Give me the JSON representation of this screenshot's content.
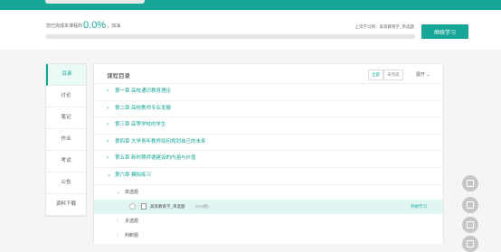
{
  "progress": {
    "prefix": "您已完成本课程的",
    "percent": "0.0%",
    "suffix": "，加油",
    "last_study": "上次学习到：高等教育学_单选题",
    "continue_label": "继续学习"
  },
  "nav": {
    "items": [
      {
        "label": "目录"
      },
      {
        "label": "讨论"
      },
      {
        "label": "笔记"
      },
      {
        "label": "作业"
      },
      {
        "label": "考试"
      },
      {
        "label": "公告"
      },
      {
        "label": "资料下载"
      }
    ]
  },
  "catalog": {
    "title": "课程目录",
    "filter_all": "全部",
    "filter_unfinished": "未完成",
    "expand_label": "展开",
    "chapters": [
      {
        "label": "第一章 高校通识教育理论"
      },
      {
        "label": "第二章 高校教师专业发展"
      },
      {
        "label": "第三章 高等学校的学生"
      },
      {
        "label": "第四章 大学青年教师如何规划自己的未来"
      },
      {
        "label": "第五章 新时期师德建设的内涵与价值"
      },
      {
        "label": "第六章 模拟练习"
      }
    ],
    "sub_single": "单选题",
    "lesson": {
      "title": "高等教育学_单选题",
      "count": "(104题)",
      "action": "开始学习"
    },
    "sub_multi": "多选题",
    "sub_judge": "判断题"
  },
  "colors": {
    "accent": "#16a695"
  }
}
